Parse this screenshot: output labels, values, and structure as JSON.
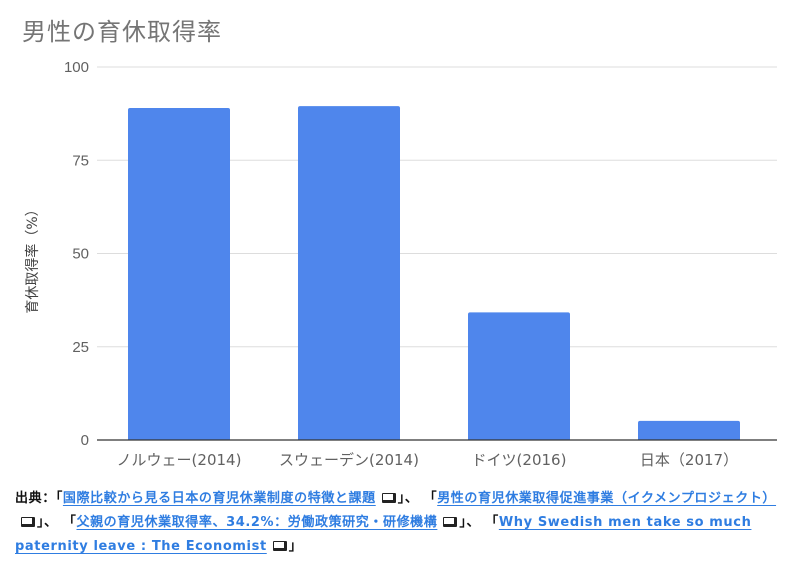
{
  "chart_data": {
    "type": "bar",
    "title": "男性の育休取得率",
    "xlabel": "",
    "ylabel": "育休取得率（%）",
    "categories": [
      "ノルウェー(2014)",
      "スウェーデン(2014)",
      "ドイツ(2016)",
      "日本（2017）"
    ],
    "values": [
      89,
      89.5,
      34.2,
      5.14
    ],
    "ylim": [
      0,
      100
    ],
    "yticks": [
      0,
      25,
      50,
      75,
      100
    ],
    "grid": true,
    "legend": "none",
    "colors": {
      "bar": "#4f86ec"
    }
  },
  "footer": {
    "prefix": "出典：",
    "open_bracket": "「",
    "close_bracket": "」",
    "separator": "、",
    "sources": [
      {
        "label": "国際比較から見る日本の育児休業制度の特徴と課題",
        "icon": "external-link-icon"
      },
      {
        "label": "男性の育児休業取得促進事業（イクメンプロジェクト）",
        "icon": "external-link-icon"
      },
      {
        "label": "父親の育児休業取得率、34.2%：労働政策研究・研修機構",
        "icon": "external-link-icon"
      },
      {
        "label": "Why Swedish men take so much paternity leave : The Economist",
        "icon": "external-link-icon"
      }
    ]
  }
}
